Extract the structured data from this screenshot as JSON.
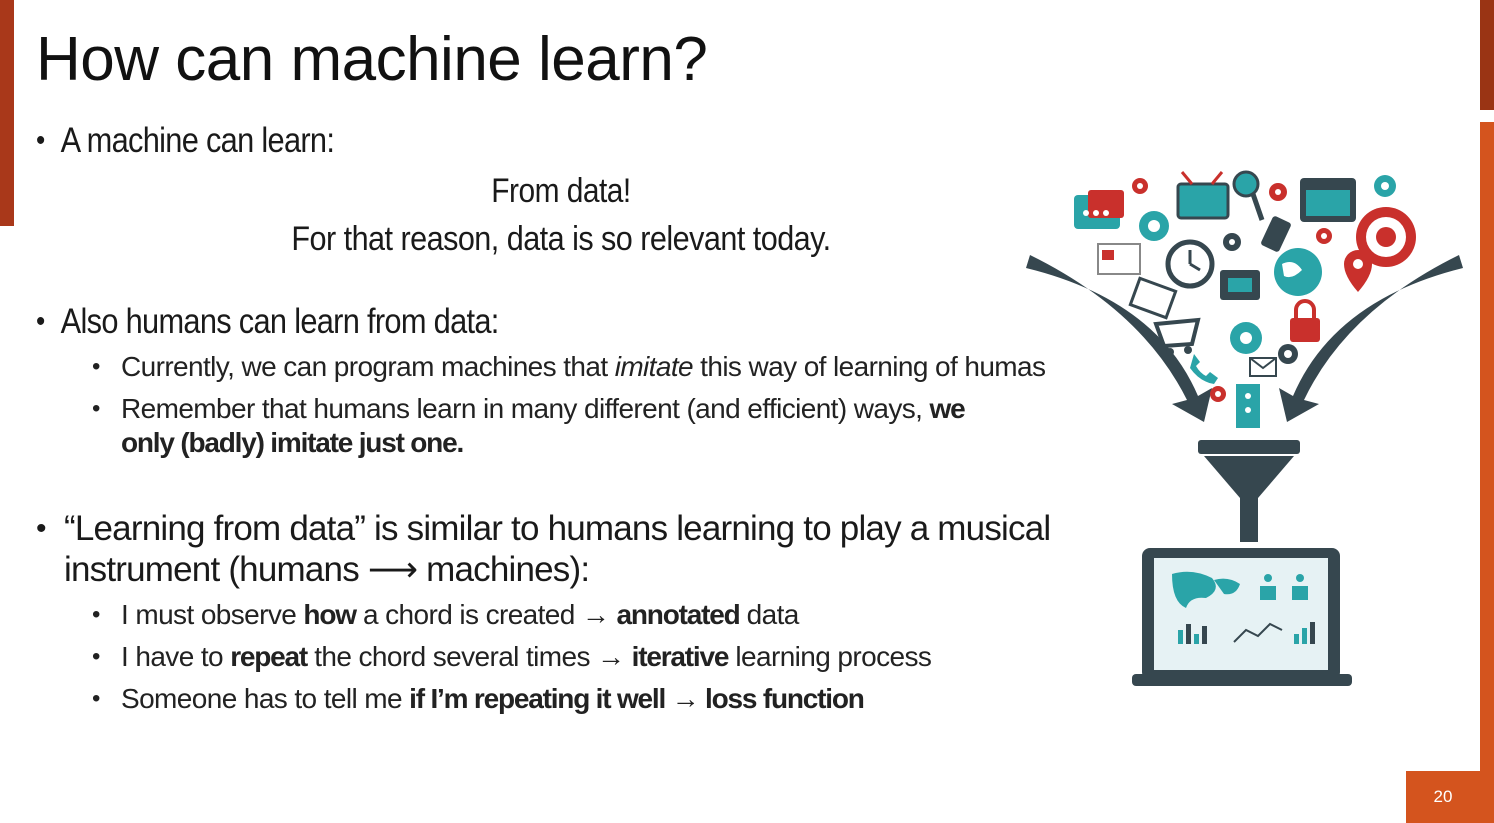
{
  "slide": {
    "title": "How can machine learn?",
    "page_number": "20"
  },
  "bullets": {
    "b1": {
      "text": "A machine can learn",
      "colon": ":",
      "center1": "From data!",
      "center2": "For that reason, data is so relevant today."
    },
    "b2": {
      "text": "Also humans can learn from data",
      "colon": ":",
      "sub1": {
        "a": "Currently, we can program machines that ",
        "b": "imitate",
        "c": " this way of learning of humas"
      },
      "sub2": {
        "a": "Remember that humans learn in many different (and efficient) ways, ",
        "b": "we only (badly) imitate just one."
      }
    },
    "b3": {
      "line1": "“Learning from data” is similar to humans learning to play a musical",
      "line2": "instrument (humans ⟶  machines):",
      "sub1": {
        "a": "I must observe ",
        "b": "how",
        "c": " a chord is created → ",
        "d": "annotated",
        "e": " data"
      },
      "sub2": {
        "a": "I have to ",
        "b": "repeat",
        "c": " the chord several times → ",
        "d": "iterative",
        "e": " learning process"
      },
      "sub3": {
        "a": "Someone has to tell me ",
        "b": "if I’m repeating it well → loss function"
      }
    }
  },
  "colors": {
    "accent": "#d4541e",
    "accent_dark": "#9a3414",
    "icon_teal": "#2aa4a8",
    "icon_dark": "#36474f",
    "icon_red": "#c9302c"
  },
  "illustration": {
    "label": "data funnel into laptop illustration",
    "icons": [
      "chat-icon",
      "gear-icon",
      "tv-icon",
      "magnifier-icon",
      "browser-icon",
      "target-icon",
      "clock-icon",
      "phone-icon",
      "globe-icon",
      "location-pin-icon",
      "calendar-icon",
      "cart-icon",
      "lock-icon",
      "mail-icon",
      "news-icon",
      "video-icon"
    ]
  }
}
